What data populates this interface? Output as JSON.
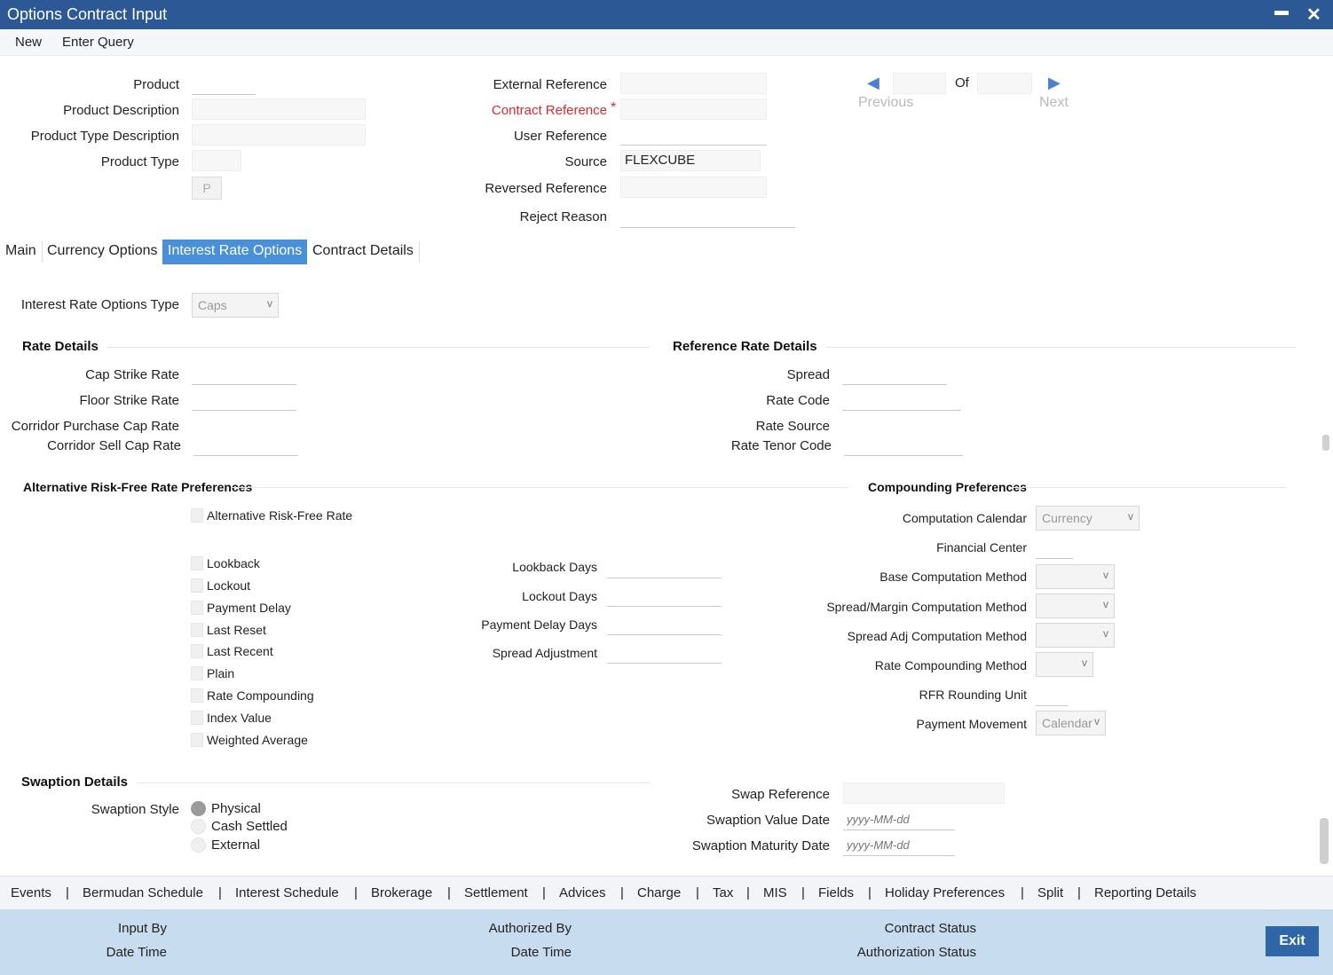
{
  "window": {
    "title": "Options Contract Input",
    "minimize_glyph": "▬",
    "close_glyph": "✕"
  },
  "toolbar": {
    "new": "New",
    "enter_query": "Enter Query"
  },
  "header": {
    "product": "Product",
    "product_description": "Product Description",
    "product_type_description": "Product Type Description",
    "product_type": "Product Type",
    "p_button": "P",
    "external_reference": "External Reference",
    "contract_reference": "Contract Reference",
    "required_mark": "*",
    "user_reference": "User Reference",
    "source": "Source",
    "source_value": "FLEXCUBE",
    "reversed_reference": "Reversed Reference",
    "reject_reason": "Reject Reason",
    "of": "Of",
    "previous": "Previous",
    "next": "Next"
  },
  "tabs": [
    "Main",
    "Currency Options",
    "Interest Rate Options",
    "Contract Details"
  ],
  "active_tab": "Interest Rate Options",
  "iro": {
    "type_label": "Interest Rate Options Type",
    "type_value": "Caps"
  },
  "rate_details": {
    "title": "Rate Details",
    "cap_strike_rate": "Cap Strike Rate",
    "floor_strike_rate": "Floor Strike Rate",
    "corridor_purchase_cap_rate": "Corridor Purchase Cap Rate",
    "corridor_sell_cap_rate": "Corridor Sell Cap Rate"
  },
  "reference_rate_details": {
    "title": "Reference Rate Details",
    "spread": "Spread",
    "rate_code": "Rate Code",
    "rate_source": "Rate Source",
    "rate_tenor_code": "Rate Tenor Code"
  },
  "arfr": {
    "title": "Alternative Risk-Free Rate Preferences",
    "alt_rfr": "Alternative Risk-Free Rate",
    "checks": [
      "Lookback",
      "Lockout",
      "Payment Delay",
      "Last Reset",
      "Last Recent",
      "Plain",
      "Rate Compounding",
      "Index Value",
      "Weighted Average"
    ],
    "lookback_days": "Lookback Days",
    "lockout_days": "Lockout Days",
    "payment_delay_days": "Payment Delay Days",
    "spread_adjustment": "Spread Adjustment"
  },
  "compounding": {
    "title": "Compounding Preferences",
    "computation_calendar": "Computation Calendar",
    "computation_calendar_value": "Currency",
    "financial_center": "Financial Center",
    "base_computation_method": "Base Computation Method",
    "spread_margin_computation_method": "Spread/Margin Computation Method",
    "spread_adj_computation_method": "Spread Adj Computation Method",
    "rate_compounding_method": "Rate Compounding Method",
    "rfr_rounding_unit": "RFR Rounding Unit",
    "payment_movement": "Payment Movement",
    "payment_movement_value": "Calendar"
  },
  "swaption": {
    "title": "Swaption Details",
    "style_label": "Swaption Style",
    "styles": [
      "Physical",
      "Cash Settled",
      "External"
    ],
    "swap_reference": "Swap Reference",
    "value_date": "Swaption Value Date",
    "maturity_date": "Swaption Maturity Date",
    "date_placeholder": "yyyy-MM-dd"
  },
  "bottom_nav": [
    "Events",
    "Bermudan Schedule",
    "Interest Schedule",
    "Brokerage",
    "Settlement",
    "Advices",
    "Charge",
    "Tax",
    "MIS",
    "Fields",
    "Holiday Preferences",
    "Split",
    "Reporting Details"
  ],
  "footer": {
    "input_by": "Input By",
    "date_time": "Date Time",
    "authorized_by": "Authorized By",
    "contract_status": "Contract Status",
    "authorization_status": "Authorization Status",
    "exit": "Exit"
  },
  "glyphs": {
    "chevron": "v",
    "prev_arrow": "◀",
    "next_arrow": "▶",
    "separator": "|"
  }
}
